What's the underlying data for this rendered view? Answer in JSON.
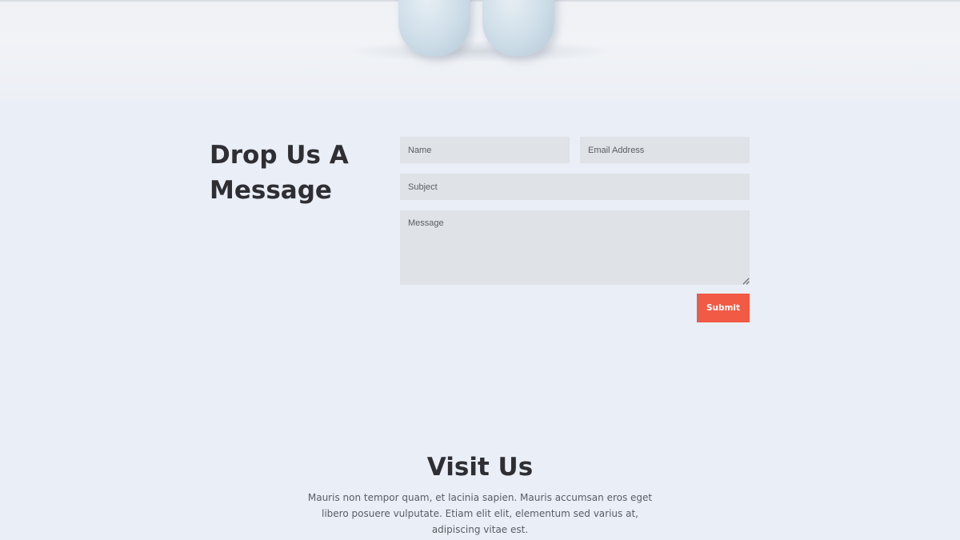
{
  "contact": {
    "title": "Drop Us A Message",
    "form": {
      "name_placeholder": "Name",
      "email_placeholder": "Email Address",
      "subject_placeholder": "Subject",
      "message_placeholder": "Message",
      "submit_label": "Submit"
    }
  },
  "visit": {
    "title": "Visit Us",
    "body": "Mauris non tempor quam, et lacinia sapien. Mauris accumsan eros eget libero posuere vulputate. Etiam elit elit, elementum sed varius at, adipiscing vitae est."
  },
  "colors": {
    "background": "#e9eef7",
    "accent": "#f15a45",
    "field_background": "#dfe2e7",
    "heading": "#2e2e33"
  }
}
